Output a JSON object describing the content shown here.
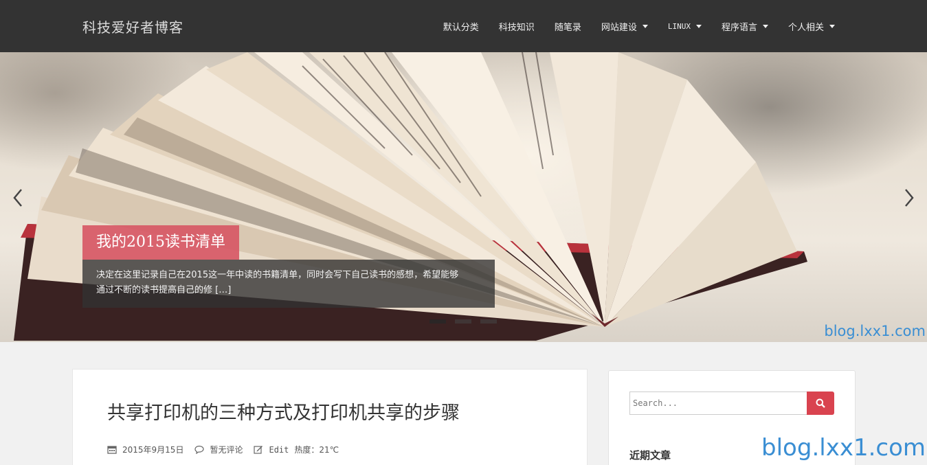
{
  "navbar": {
    "brand": "科技爱好者博客",
    "items": [
      {
        "label": "默认分类",
        "has_dropdown": false
      },
      {
        "label": "科技知识",
        "has_dropdown": false
      },
      {
        "label": "随笔录",
        "has_dropdown": false
      },
      {
        "label": "网站建设",
        "has_dropdown": true
      },
      {
        "label": "LINUX",
        "has_dropdown": true
      },
      {
        "label": "程序语言",
        "has_dropdown": true
      },
      {
        "label": "个人相关",
        "has_dropdown": true
      }
    ]
  },
  "slider": {
    "title": "我的2015读书清单",
    "excerpt_line1": "决定在这里记录自己在2015这一年中读的书籍清单，同时会写下自己读书的感想，希望能够",
    "excerpt_line2": "通过不断的读书提高自己的修 […]",
    "slide_count": 3,
    "active_slide": 1,
    "watermark": "blog.lxx1.com"
  },
  "post": {
    "title": "共享打印机的三种方式及打印机共享的步骤",
    "date": "2015年9月15日",
    "comments": "暂无评论",
    "edit": "Edit",
    "heat": "热度：21℃"
  },
  "sidebar": {
    "search_placeholder": "Search...",
    "recent_title": "近期文章"
  },
  "watermark": "blog.lxx1.com",
  "colors": {
    "navbar_bg": "#333333",
    "accent": "#d9434f",
    "caption_title_bg": "#d65261",
    "watermark": "#3a8ed3"
  }
}
